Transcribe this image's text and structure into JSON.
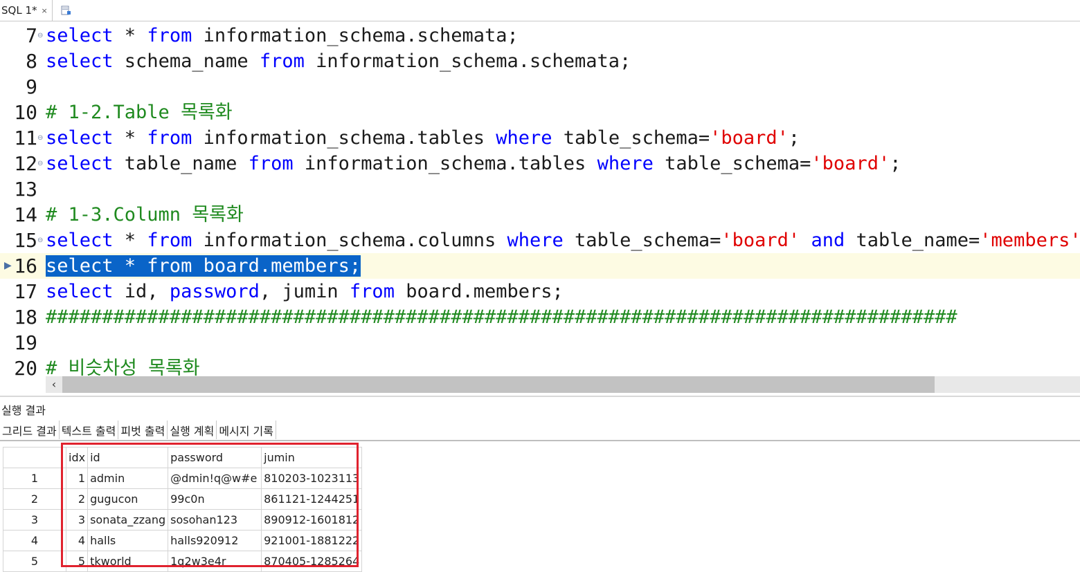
{
  "tab": {
    "label": "SQL 1*",
    "close": "×"
  },
  "editor": {
    "lines": [
      {
        "n": "7",
        "fold": true,
        "tokens": [
          [
            "kw",
            "select"
          ],
          [
            "p",
            " * "
          ],
          [
            "kw",
            "from"
          ],
          [
            "p",
            " information_schema.schemata;"
          ]
        ]
      },
      {
        "n": "8",
        "fold": false,
        "tokens": [
          [
            "kw",
            "select"
          ],
          [
            "p",
            " schema_name "
          ],
          [
            "kw",
            "from"
          ],
          [
            "p",
            " information_schema.schemata;"
          ]
        ]
      },
      {
        "n": "9",
        "fold": false,
        "tokens": []
      },
      {
        "n": "10",
        "fold": false,
        "tokens": [
          [
            "cm",
            "# 1-2.Table 목록화"
          ]
        ]
      },
      {
        "n": "11",
        "fold": true,
        "tokens": [
          [
            "kw",
            "select"
          ],
          [
            "p",
            " * "
          ],
          [
            "kw",
            "from"
          ],
          [
            "p",
            " information_schema.tables "
          ],
          [
            "kw",
            "where"
          ],
          [
            "p",
            " table_schema="
          ],
          [
            "str",
            "'board'"
          ],
          [
            "p",
            ";"
          ]
        ]
      },
      {
        "n": "12",
        "fold": true,
        "tokens": [
          [
            "kw",
            "select"
          ],
          [
            "p",
            " table_name "
          ],
          [
            "kw",
            "from"
          ],
          [
            "p",
            " information_schema.tables "
          ],
          [
            "kw",
            "where"
          ],
          [
            "p",
            " table_schema="
          ],
          [
            "str",
            "'board'"
          ],
          [
            "p",
            ";"
          ]
        ]
      },
      {
        "n": "13",
        "fold": false,
        "tokens": []
      },
      {
        "n": "14",
        "fold": false,
        "tokens": [
          [
            "cm",
            "# 1-3.Column 목록화"
          ]
        ]
      },
      {
        "n": "15",
        "fold": true,
        "tokens": [
          [
            "kw",
            "select"
          ],
          [
            "p",
            " * "
          ],
          [
            "kw",
            "from"
          ],
          [
            "p",
            " information_schema.columns "
          ],
          [
            "kw",
            "where"
          ],
          [
            "p",
            " table_schema="
          ],
          [
            "str",
            "'board'"
          ],
          [
            "p",
            " "
          ],
          [
            "kw",
            "and"
          ],
          [
            "p",
            " table_name="
          ],
          [
            "str",
            "'members'"
          ],
          [
            "p",
            ";"
          ]
        ]
      },
      {
        "n": "16",
        "fold": false,
        "current": true,
        "selected": "select * from board.members;",
        "tokens": []
      },
      {
        "n": "17",
        "fold": false,
        "tokens": [
          [
            "kw",
            "select"
          ],
          [
            "p",
            " id, "
          ],
          [
            "kw",
            "password"
          ],
          [
            "p",
            ", jumin "
          ],
          [
            "kw",
            "from"
          ],
          [
            "p",
            " board.members;"
          ]
        ]
      },
      {
        "n": "18",
        "fold": false,
        "tokens": [
          [
            "cm",
            "#################################################################################"
          ]
        ]
      },
      {
        "n": "19",
        "fold": false,
        "tokens": []
      },
      {
        "n": "20",
        "fold": false,
        "tokens": [
          [
            "cm",
            "# 비슷차성 목록화"
          ]
        ]
      }
    ]
  },
  "results": {
    "title": "실행 결과",
    "tabs": [
      "그리드 결과",
      "텍스트 출력",
      "피벗 출력",
      "실행 계획",
      "메시지 기록"
    ],
    "columns": [
      "idx",
      "id",
      "password",
      "jumin"
    ],
    "rows": [
      {
        "rn": "1",
        "idx": "1",
        "id": "admin",
        "password": "@dmin!q@w#e",
        "jumin": "810203-1023113"
      },
      {
        "rn": "2",
        "idx": "2",
        "id": "gugucon",
        "password": "99c0n",
        "jumin": "861121-1244251"
      },
      {
        "rn": "3",
        "idx": "3",
        "id": "sonata_zzang",
        "password": "sosohan123",
        "jumin": "890912-1601812"
      },
      {
        "rn": "4",
        "idx": "4",
        "id": "halls",
        "password": "halls920912",
        "jumin": "921001-1881222"
      },
      {
        "rn": "5",
        "idx": "5",
        "id": "tkworld",
        "password": "1q2w3e4r",
        "jumin": "870405-1285264"
      }
    ]
  },
  "colors": {
    "keyword": "#0000ff",
    "string": "#e00000",
    "comment": "#1f8a1f",
    "selection": "#0a64c8",
    "highlight_box": "#e0222e"
  }
}
